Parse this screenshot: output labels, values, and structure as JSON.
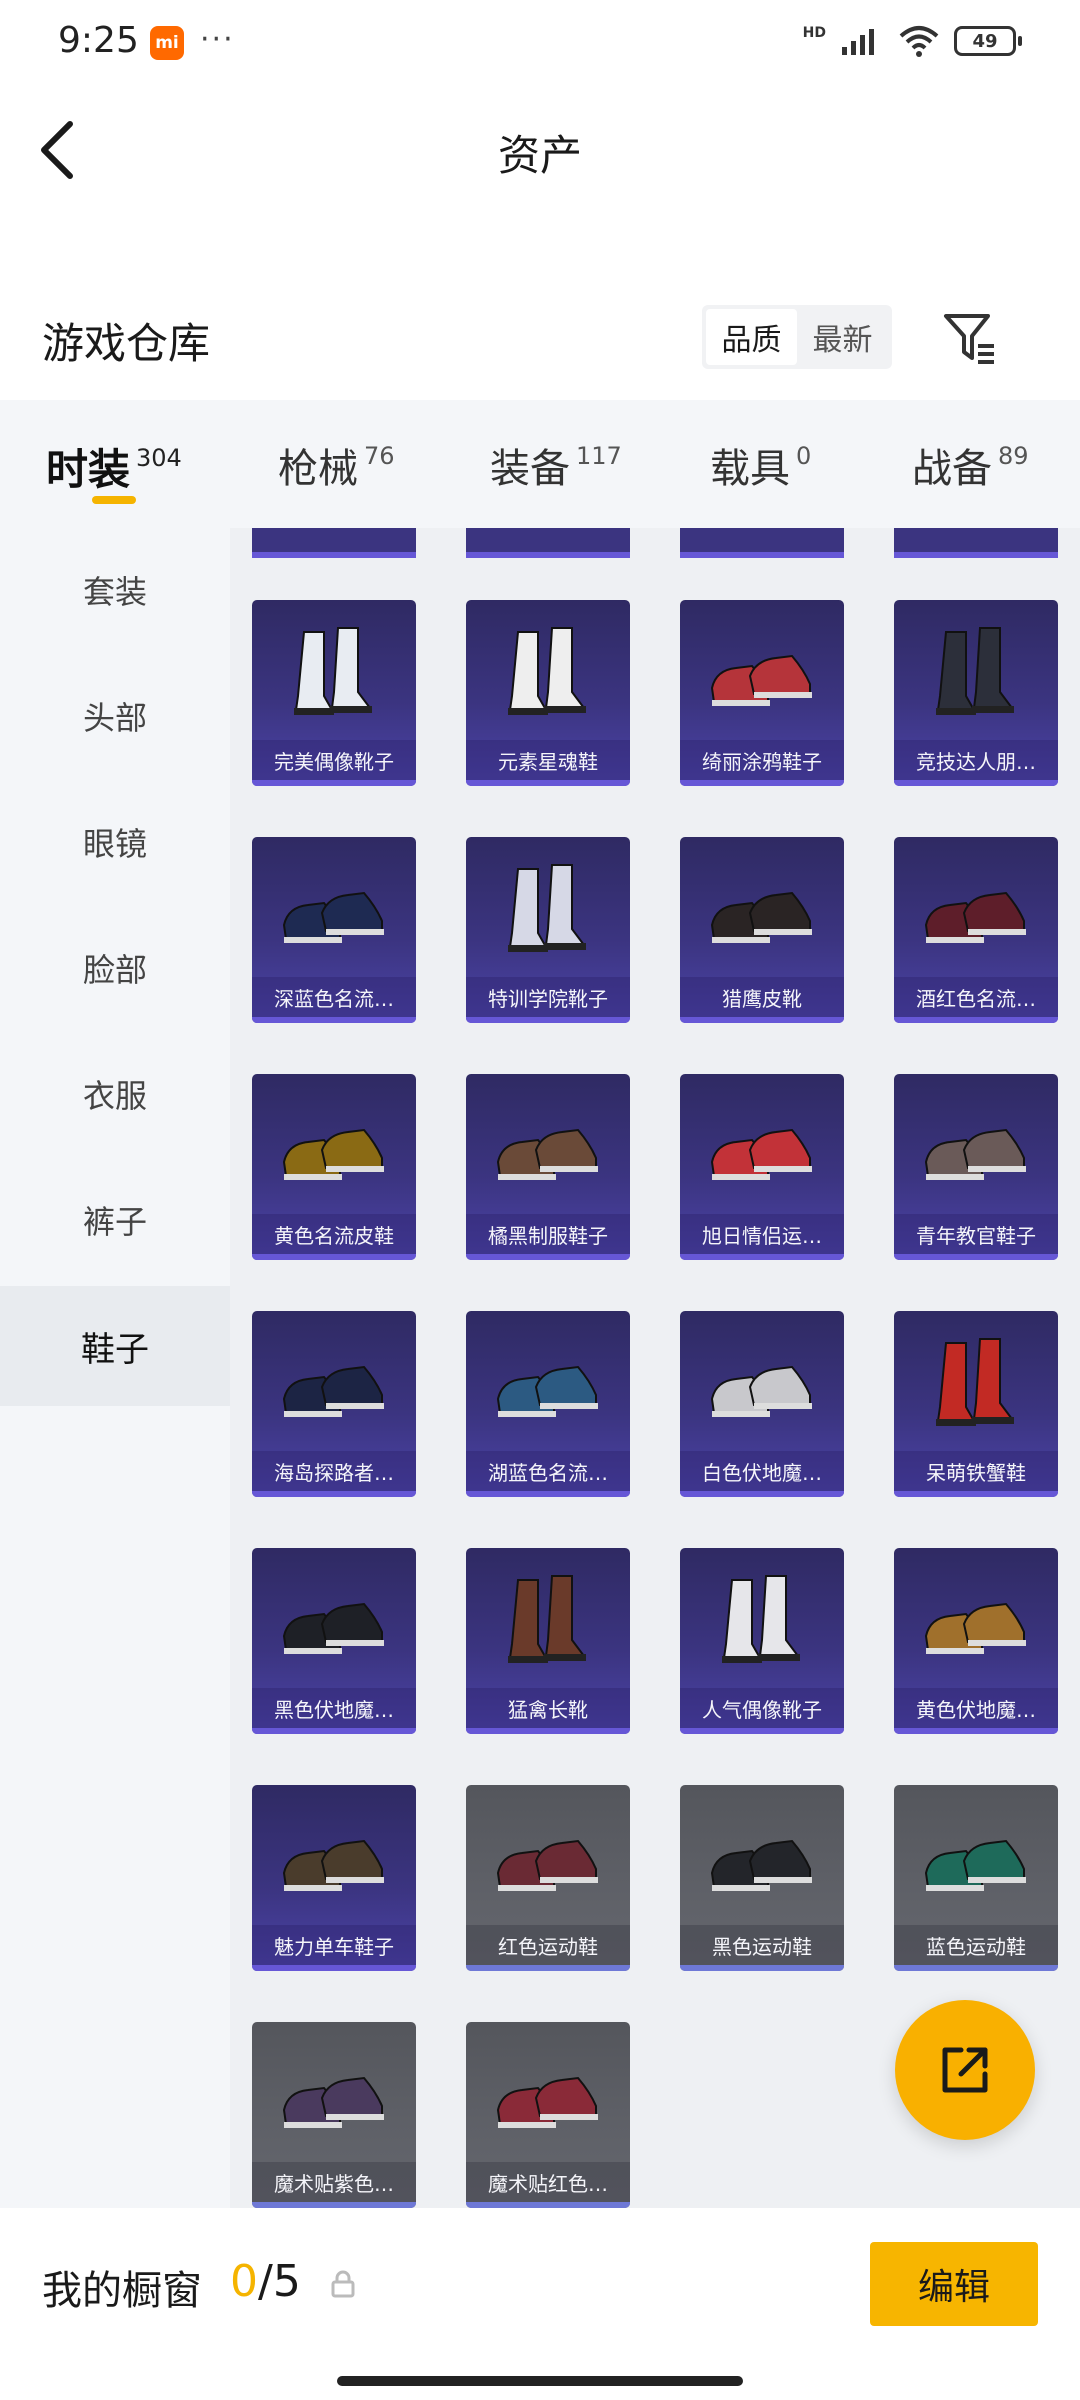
{
  "status": {
    "time": "9:25",
    "mi": "mi",
    "dots": "···",
    "hd": "HD",
    "battery": "49"
  },
  "header": {
    "title": "资产"
  },
  "warehouse": {
    "title": "游戏仓库",
    "sort_quality": "品质",
    "sort_newest": "最新"
  },
  "categories": [
    {
      "label": "时装",
      "count": "304"
    },
    {
      "label": "枪械",
      "count": "76"
    },
    {
      "label": "装备",
      "count": "117"
    },
    {
      "label": "载具",
      "count": "0"
    },
    {
      "label": "战备",
      "count": "89"
    }
  ],
  "side_nav": [
    "套装",
    "头部",
    "眼镜",
    "脸部",
    "衣服",
    "裤子",
    "鞋子"
  ],
  "items": [
    {
      "name": "完美偶像靴子",
      "bg": "purple",
      "color": "#e8ecf2",
      "boot": true
    },
    {
      "name": "元素星魂鞋",
      "bg": "purple",
      "color": "#eeeeee",
      "boot": true
    },
    {
      "name": "绮丽涂鸦鞋子",
      "bg": "purple",
      "color": "#b5343a",
      "boot": false
    },
    {
      "name": "竞技达人朋…",
      "bg": "purple",
      "color": "#2c2f3a",
      "boot": true
    },
    {
      "name": "深蓝色名流…",
      "bg": "purple",
      "color": "#1e2a52",
      "boot": false
    },
    {
      "name": "特训学院靴子",
      "bg": "purple",
      "color": "#d6d8e6",
      "boot": true
    },
    {
      "name": "猎鹰皮靴",
      "bg": "purple",
      "color": "#2a2424",
      "boot": false
    },
    {
      "name": "酒红色名流…",
      "bg": "purple",
      "color": "#5e1e2a",
      "boot": false
    },
    {
      "name": "黄色名流皮鞋",
      "bg": "purple",
      "color": "#8a6a14",
      "boot": false
    },
    {
      "name": "橘黑制服鞋子",
      "bg": "purple",
      "color": "#6a4a38",
      "boot": false
    },
    {
      "name": "旭日情侣运…",
      "bg": "purple",
      "color": "#c23238",
      "boot": false
    },
    {
      "name": "青年教官鞋子",
      "bg": "purple",
      "color": "#6a5a58",
      "boot": false
    },
    {
      "name": "海岛探路者…",
      "bg": "purple",
      "color": "#1c2444",
      "boot": false
    },
    {
      "name": "湖蓝色名流…",
      "bg": "purple",
      "color": "#2c5a82",
      "boot": false
    },
    {
      "name": "白色伏地魔…",
      "bg": "purple",
      "color": "#c8c8cc",
      "boot": false
    },
    {
      "name": "呆萌铁蟹鞋",
      "bg": "purple",
      "color": "#c22a24",
      "boot": true
    },
    {
      "name": "黑色伏地魔…",
      "bg": "purple",
      "color": "#1e2026",
      "boot": false
    },
    {
      "name": "猛禽长靴",
      "bg": "purple",
      "color": "#6a3a2a",
      "boot": true
    },
    {
      "name": "人气偶像靴子",
      "bg": "purple",
      "color": "#e6e6ea",
      "boot": true
    },
    {
      "name": "黄色伏地魔…",
      "bg": "purple",
      "color": "#a0702c",
      "boot": false
    },
    {
      "name": "魅力单车鞋子",
      "bg": "purple",
      "color": "#4a3c2c",
      "boot": false
    },
    {
      "name": "红色运动鞋",
      "bg": "gray",
      "color": "#6a2a34",
      "boot": false
    },
    {
      "name": "黑色运动鞋",
      "bg": "gray",
      "color": "#23252a",
      "boot": false
    },
    {
      "name": "蓝色运动鞋",
      "bg": "gray",
      "color": "#1e6a5a",
      "boot": false
    },
    {
      "name": "魔术贴紫色…",
      "bg": "gray",
      "color": "#4a3a5e",
      "boot": false
    },
    {
      "name": "魔术贴红色…",
      "bg": "gray",
      "color": "#8a2a38",
      "boot": false
    }
  ],
  "bottom": {
    "window_label": "我的橱窗",
    "count_current": "0",
    "count_sep": "/",
    "count_max": "5",
    "edit": "编辑"
  },
  "colors": {
    "accent": "#f5b400",
    "card_purple": "#3b3480",
    "card_gray": "#5f6168"
  }
}
